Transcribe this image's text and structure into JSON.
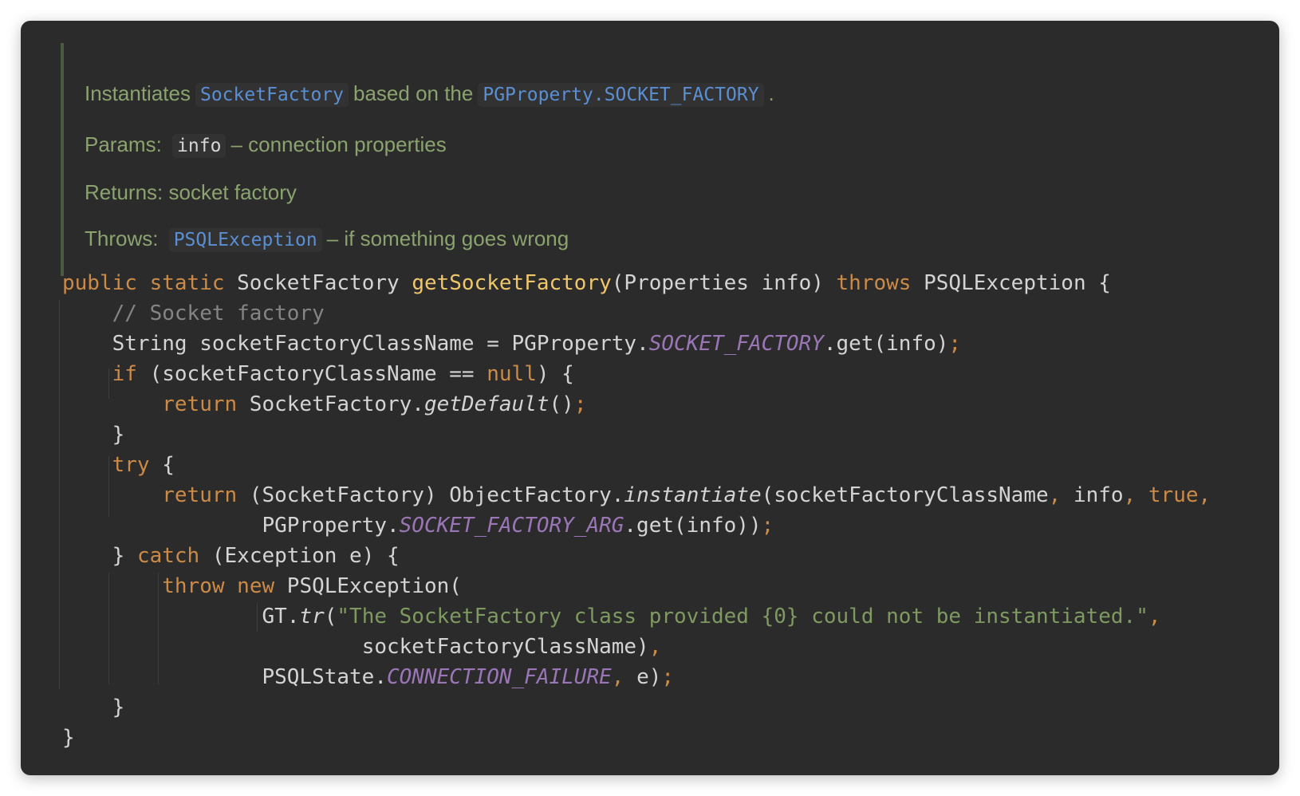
{
  "doc": {
    "summary_text_before": "Instantiates",
    "summary_link_1": "SocketFactory",
    "summary_text_mid": "based on the",
    "summary_link_2": "PGProperty.SOCKET_FACTORY",
    "summary_text_after": ".",
    "params_label": "Params:",
    "params_name": "info",
    "params_desc": "– connection properties",
    "returns_label": "Returns:",
    "returns_desc": "socket factory",
    "throws_label": "Throws:",
    "throws_type": "PSQLException",
    "throws_desc": "– if something goes wrong"
  },
  "code": {
    "l1_public": "public",
    "l1_static": "static",
    "l1_rettype": "SocketFactory",
    "l1_name": "getSocketFactory",
    "l1_params": "(Properties info)",
    "l1_throws": "throws",
    "l1_exc": "PSQLException {",
    "l2_comment": "// Socket factory",
    "l3_decl": "String socketFactoryClassName = PGProperty.",
    "l3_field": "SOCKET_FACTORY",
    "l3_tail": ".get(info)",
    "l3_semi": ";",
    "l4_if": "if",
    "l4_cond": " (socketFactoryClassName == ",
    "l4_null": "null",
    "l4_tail": ") {",
    "l5_return": "return",
    "l5_obj": " SocketFactory.",
    "l5_method": "getDefault",
    "l5_tail": "()",
    "l5_semi": ";",
    "l6_close": "}",
    "l7_try": "try",
    "l7_tail": " {",
    "l8_return": "return",
    "l8_cast": " (SocketFactory) ObjectFactory.",
    "l8_method": "instantiate",
    "l8_args": "(socketFactoryClassName",
    "l8_comma1": ",",
    "l8_info": " info",
    "l8_comma2": ",",
    "l8_true": " true",
    "l8_comma3": ",",
    "l9_obj": "PGProperty.",
    "l9_field": "SOCKET_FACTORY_ARG",
    "l9_tail": ".get(info))",
    "l9_semi": ";",
    "l10_close": "} ",
    "l10_catch": "catch",
    "l10_tail": " (Exception e) {",
    "l11_throw": "throw",
    "l11_new": " new",
    "l11_tail": " PSQLException(",
    "l12_obj": "GT.",
    "l12_method": "tr",
    "l12_open": "(",
    "l12_str": "\"The SocketFactory class provided {0} could not be instantiated.\"",
    "l12_comma": ",",
    "l13_arg": "socketFactoryClassName)",
    "l13_comma": ",",
    "l14_obj": "PSQLState.",
    "l14_field": "CONNECTION_FAILURE",
    "l14_comma": ",",
    "l14_e": " e)",
    "l14_semi": ";",
    "l15_close": "}",
    "l16_close": "}"
  },
  "colors": {
    "background": "#2b2b2b",
    "keyword": "#cc8a47",
    "method_decl": "#f0c66a",
    "static_field": "#9a76b6",
    "comment": "#858585",
    "string": "#7e9a61",
    "doc_text": "#8ba36e",
    "doc_link": "#5b8fd4"
  }
}
